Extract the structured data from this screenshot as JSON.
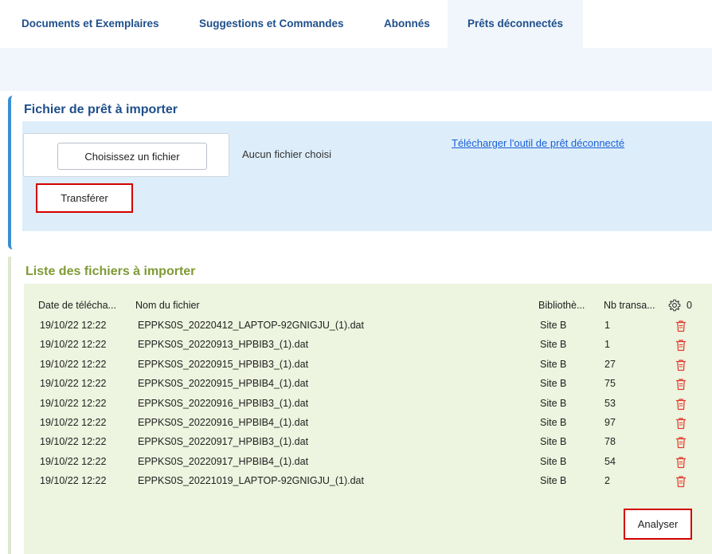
{
  "tabs": [
    {
      "label": "Documents et Exemplaires"
    },
    {
      "label": "Suggestions et Commandes"
    },
    {
      "label": "Abonnés"
    },
    {
      "label": "Prêts déconnectés",
      "active": true
    }
  ],
  "import_panel": {
    "title": "Fichier de prêt à importer",
    "choose_label": "Choisissez un fichier",
    "no_file_text": "Aucun fichier choisi",
    "download_link": "Télécharger l'outil de prêt déconnecté",
    "transfer_label": "Transférer"
  },
  "list_panel": {
    "title": "Liste des fichiers à importer",
    "columns": [
      "Date de télécha...",
      "Nom du fichier",
      "Bibliothè...",
      "Nb transa..."
    ],
    "settings_count": "0",
    "rows": [
      {
        "date": "19/10/22 12:22",
        "name": "EPPKS0S_20220412_LAPTOP-92GNIGJU_(1).dat",
        "library": "Site B",
        "count": "1"
      },
      {
        "date": "19/10/22 12:22",
        "name": "EPPKS0S_20220913_HPBIB3_(1).dat",
        "library": "Site B",
        "count": "1"
      },
      {
        "date": "19/10/22 12:22",
        "name": "EPPKS0S_20220915_HPBIB3_(1).dat",
        "library": "Site B",
        "count": "27"
      },
      {
        "date": "19/10/22 12:22",
        "name": "EPPKS0S_20220915_HPBIB4_(1).dat",
        "library": "Site B",
        "count": "75"
      },
      {
        "date": "19/10/22 12:22",
        "name": "EPPKS0S_20220916_HPBIB3_(1).dat",
        "library": "Site B",
        "count": "53"
      },
      {
        "date": "19/10/22 12:22",
        "name": "EPPKS0S_20220916_HPBIB4_(1).dat",
        "library": "Site B",
        "count": "97"
      },
      {
        "date": "19/10/22 12:22",
        "name": "EPPKS0S_20220917_HPBIB3_(1).dat",
        "library": "Site B",
        "count": "78"
      },
      {
        "date": "19/10/22 12:22",
        "name": "EPPKS0S_20220917_HPBIB4_(1).dat",
        "library": "Site B",
        "count": "54"
      },
      {
        "date": "19/10/22 12:22",
        "name": "EPPKS0S_20221019_LAPTOP-92GNIGJU_(1).dat",
        "library": "Site B",
        "count": "2"
      }
    ],
    "row_icon": "trash-icon",
    "analyse_label": "Analyser"
  },
  "colors": {
    "tab_text": "#1f4f8a",
    "accent_blue": "#3b8fd0",
    "list_title": "#7f9a35",
    "delete_red": "#e23b2e",
    "highlight_red": "#d40000"
  }
}
